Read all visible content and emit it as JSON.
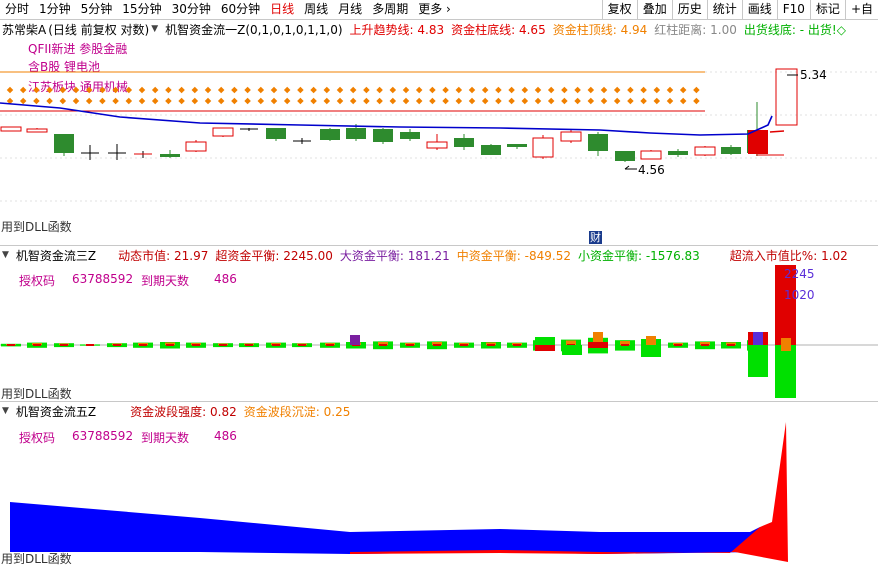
{
  "toolbar": {
    "periods": [
      "分时",
      "1分钟",
      "5分钟",
      "15分钟",
      "30分钟",
      "60分钟",
      "日线",
      "周线",
      "月线",
      "多周期",
      "更多 ›"
    ],
    "active_index": 6,
    "right_buttons": [
      "复权",
      "叠加",
      "历史",
      "统计",
      "画线",
      "F10",
      "标记",
      "+自"
    ]
  },
  "pane1": {
    "stock": "苏常柴A",
    "mode": "(日线 前复权 对数)",
    "indicator": "机智资金流一Z(0,1,0,1,0,1,1,0)",
    "uptrend_label": "上升趋势线:",
    "uptrend_value": "4.83",
    "bottom_label": "资金柱底线:",
    "bottom_value": "4.65",
    "top_label": "资金柱顶线:",
    "top_value": "4.94",
    "red_dist_label": "红柱距离:",
    "red_dist_value": "1.00",
    "sell_label": "出货线底:",
    "sell_value": "- 出货!◇",
    "concepts": [
      "QFII新进 参股金融",
      "含B股 锂电池",
      "江苏板块 通用机械"
    ],
    "high_label": "5.34",
    "low_label": "4.56",
    "dll": "用到DLL函数",
    "marker": "财",
    "colors": {
      "up": "#e00000",
      "down": "#2e8b2e",
      "ma": "#0000cc",
      "orange": "#f08000",
      "magenta": "#c0008c"
    }
  },
  "pane2": {
    "indicator": "机智资金流三Z",
    "dyn_label": "动态市值:",
    "dyn_value": "21.97",
    "super_label": "超资金平衡:",
    "super_value": "2245.00",
    "big_label": "大资金平衡:",
    "big_value": "181.21",
    "mid_label": "中资金平衡:",
    "mid_value": "-849.52",
    "small_label": "小资金平衡:",
    "small_value": "-1576.83",
    "inflow_label": "超流入市值比%:",
    "inflow_value": "1.02",
    "auth_label": "授权码",
    "auth_value": "63788592",
    "days_label": "到期天数",
    "days_value": "486",
    "val_top": "2245",
    "val_mid": "1020",
    "dll": "用到DLL函数"
  },
  "pane3": {
    "indicator": "机智资金流五Z",
    "strength_label": "资金波段强度:",
    "strength_value": "0.82",
    "settle_label": "资金波段沉淀:",
    "settle_value": "0.25",
    "auth_label": "授权码",
    "auth_value": "63788592",
    "days_label": "到期天数",
    "days_value": "486",
    "dll": "用到DLL函数"
  }
}
